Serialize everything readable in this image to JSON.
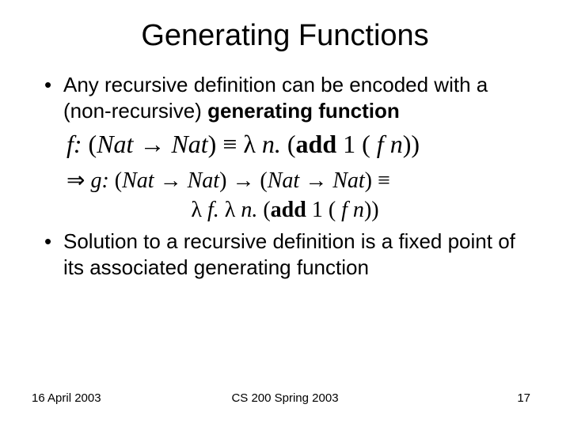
{
  "title": "Generating Functions",
  "bullet1_a": "Any recursive definition can be encoded with a (non-recursive) ",
  "bullet1_b": "generating function",
  "eq1": {
    "f": "f: ",
    "lp": "(",
    "nat1": "Nat ",
    "arr1": "→ ",
    "nat2": "Nat",
    "rp": ") ",
    "eqv": "≡ ",
    "lam": "λ ",
    "n": "n. ",
    "lp2": "(",
    "add": "add",
    "one": " 1 ( ",
    "fvar": "f n",
    "close": "))"
  },
  "eq2": {
    "imp": "⇒ ",
    "g": "g: ",
    "lp": "(",
    "nat1": "Nat ",
    "arr1": "→ ",
    "nat2": "Nat",
    "rp": ") ",
    "arr2": "→ ",
    "lp2": "(",
    "nat3": "Nat ",
    "arr3": "→ ",
    "nat4": "Nat",
    "rp2": ") ",
    "eqv": "≡"
  },
  "eq3": {
    "lamf": "λ ",
    "f": "f. ",
    "lamn": "λ ",
    "n": "n. ",
    "lp": "(",
    "add": "add",
    "one": " 1 ( ",
    "fvar": "f n",
    "close": "))"
  },
  "bullet2": "Solution to a recursive definition is a fixed point of its associated generating function",
  "footer": {
    "left": "16 April 2003",
    "center": "CS 200 Spring 2003",
    "right": "17"
  }
}
